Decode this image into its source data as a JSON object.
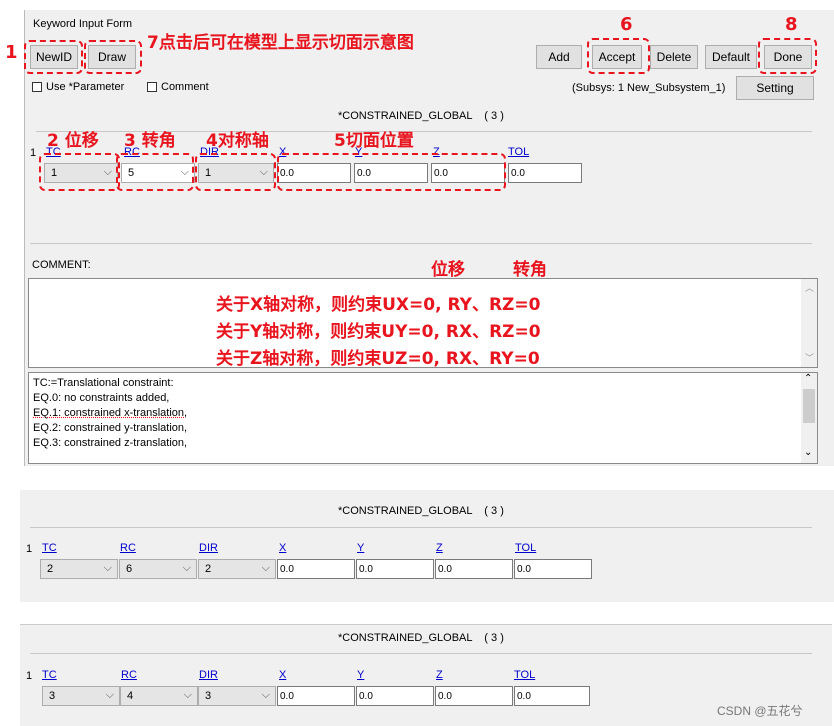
{
  "window": {
    "title": "Keyword Input Form"
  },
  "toolbar": {
    "newid": "NewID",
    "draw": "Draw",
    "add": "Add",
    "accept": "Accept",
    "delete": "Delete",
    "default": "Default",
    "done": "Done",
    "setting": "Setting"
  },
  "options": {
    "use_parameter": "Use *Parameter",
    "comment": "Comment",
    "subsys": "(Subsys: 1 New_Subsystem_1)"
  },
  "keyword_title": "*CONSTRAINED_GLOBAL    ( 3 )",
  "keyword_title_2": "*CONSTRAINED_GLOBAL    ( 3 )",
  "keyword_title_3": "*CONSTRAINED_GLOBAL    ( 3 )",
  "fields": {
    "row": "1",
    "tc": "TC",
    "rc": "RC",
    "dir": "DIR",
    "x": "X",
    "y": "Y",
    "z": "Z",
    "tol": "TOL"
  },
  "form1": {
    "tc": "1",
    "rc": "5",
    "dir": "1",
    "x": "0.0",
    "y": "0.0",
    "z": "0.0",
    "tol": "0.0"
  },
  "form2": {
    "tc": "2",
    "rc": "6",
    "dir": "2",
    "x": "0.0",
    "y": "0.0",
    "z": "0.0",
    "tol": "0.0"
  },
  "form3": {
    "tc": "3",
    "rc": "4",
    "dir": "3",
    "x": "0.0",
    "y": "0.0",
    "z": "0.0",
    "tol": "0.0"
  },
  "comment_label": "COMMENT:",
  "help": [
    "TC:=Translational constraint:",
    "EQ.0: no constraints added,",
    "EQ.1: constrained x-translation,",
    "EQ.2: constrained y-translation,",
    "EQ.3: constrained z-translation,"
  ],
  "annotations": {
    "n1": "1",
    "n6": "6",
    "n8": "8",
    "n7": "7点击后可在模型上显示切面示意图",
    "n2": "2 位移",
    "n3": "3 转角",
    "n4": "4对称轴",
    "n5": "5切面位置",
    "disp": "位移",
    "rot": "转角",
    "rule_x": "关于X轴对称，则约束UX=0, RY、RZ=0",
    "rule_y": "关于Y轴对称，则约束UY=0, RX、RZ=0",
    "rule_z": "关于Z轴对称，则约束UZ=0, RX、RY=0"
  },
  "watermark": "CSDN @五花兮",
  "colors": {
    "annotation": "#e8141e",
    "panel": "#f0f0f0",
    "link": "#0000cc"
  }
}
